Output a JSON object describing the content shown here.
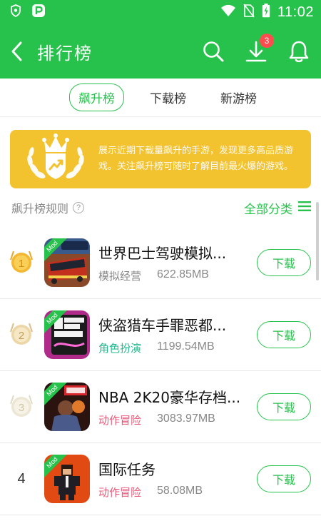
{
  "statusbar": {
    "time": "11:02"
  },
  "toolbar": {
    "title": "排行榜",
    "download_badge": "3"
  },
  "tabs": [
    {
      "label": "飙升榜",
      "active": true
    },
    {
      "label": "下载榜",
      "active": false
    },
    {
      "label": "新游榜",
      "active": false
    }
  ],
  "banner": {
    "text": "展示近期下载量飙升的手游，发现更多高品质游戏。关注飙升榜可随时了解目前最火爆的游戏。"
  },
  "rulebar": {
    "rule_label": "飙升榜规则",
    "help_glyph": "?",
    "all_categories": "全部分类"
  },
  "list": [
    {
      "rank": "1",
      "name": "世界巴士驾驶模拟...",
      "category": "模拟经营",
      "size": "622.85MB",
      "download": "下载",
      "mod": "Mod"
    },
    {
      "rank": "2",
      "name": "侠盗猎车手罪恶都...",
      "category": "角色扮演",
      "size": "1199.54MB",
      "download": "下载",
      "mod": "Mod"
    },
    {
      "rank": "3",
      "name": "NBA 2K20豪华存档...",
      "category": "动作冒险",
      "size": "3083.97MB",
      "download": "下载",
      "mod": "Mod"
    },
    {
      "rank": "4",
      "name": "国际任务",
      "category": "动作冒险",
      "size": "58.08MB",
      "download": "下载",
      "mod": "Mod"
    }
  ],
  "colors": {
    "primary": "#27c24c",
    "banner": "#f3c32f",
    "badge": "#ff4d4f",
    "teal": "#27b88f",
    "pink": "#e85b7a"
  },
  "icons": [
    "shield-icon",
    "parking-icon",
    "wifi-icon",
    "no-sim-icon",
    "battery-icon",
    "back-arrow-icon",
    "search-icon",
    "download-icon",
    "bell-icon",
    "help-icon",
    "menu-icon",
    "crown-emblem-icon",
    "medal-gold-icon",
    "medal-silver-icon",
    "medal-bronze-icon"
  ]
}
